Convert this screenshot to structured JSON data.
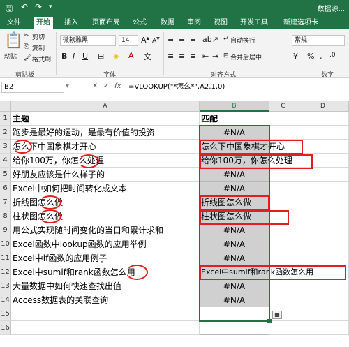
{
  "titlebar": {
    "save_icon": "save-icon",
    "undo_icon": "undo-icon",
    "redo_icon": "redo-icon",
    "title": "数据源..."
  },
  "tabs": [
    "文件",
    "开始",
    "插入",
    "页面布局",
    "公式",
    "数据",
    "审阅",
    "视图",
    "开发工具",
    "新建选项卡"
  ],
  "active_tab": 1,
  "ribbon": {
    "paste": "粘贴",
    "cut": "剪切",
    "copy": "复制",
    "format_painter": "格式刷",
    "clipboard_label": "剪贴板",
    "font_name": "微软雅黑",
    "font_size": "14",
    "bold": "B",
    "italic": "I",
    "underline": "U",
    "font_label": "字体",
    "wrap_text": "自动换行",
    "merge_center": "合并后居中",
    "align_label": "对齐方式",
    "number_format": "常规",
    "number_label": "数字",
    "percent": "%",
    "comma": ","
  },
  "formula_bar": {
    "cell_ref": "B2",
    "cancel": "✕",
    "confirm": "✓",
    "fx": "fx",
    "formula": "=VLOOKUP(\"*怎么*\",A2,1,0)"
  },
  "columns": [
    "A",
    "B",
    "C",
    "D"
  ],
  "rows": [
    {
      "n": "1",
      "a": "主题",
      "b": "匹配"
    },
    {
      "n": "2",
      "a": "跑步是最好的运动，是最有价值的投资",
      "b": "#N/A"
    },
    {
      "n": "3",
      "a": "怎么下中国象棋才开心",
      "b": "怎么下中国象棋才开心"
    },
    {
      "n": "4",
      "a": "给你100万，你怎么处理",
      "b": "给你100万，你怎么处理"
    },
    {
      "n": "5",
      "a": "好朋友应该是什么样子的",
      "b": "#N/A"
    },
    {
      "n": "6",
      "a": "Excel中如何把时间转化成文本",
      "b": "#N/A"
    },
    {
      "n": "7",
      "a": "折线图怎么做",
      "b": "折线图怎么做"
    },
    {
      "n": "8",
      "a": "柱状图怎么做",
      "b": "柱状图怎么做"
    },
    {
      "n": "9",
      "a": "用公式实现随时间变化的当日和累计求和",
      "b": "#N/A"
    },
    {
      "n": "10",
      "a": "Excel函数中lookup函数的应用举例",
      "b": "#N/A"
    },
    {
      "n": "11",
      "a": "Excel中if函数的应用例子",
      "b": "#N/A"
    },
    {
      "n": "12",
      "a": "Excel中sumif和rank函数怎么用",
      "b": "Excel中sumif和rank函数怎么用"
    },
    {
      "n": "13",
      "a": "大量数据中如何快速查找出值",
      "b": "#N/A"
    },
    {
      "n": "14",
      "a": "Access数据表的关联查询",
      "b": "#N/A"
    },
    {
      "n": "15",
      "a": "",
      "b": ""
    },
    {
      "n": "16",
      "a": "",
      "b": ""
    }
  ],
  "colors": {
    "excel_green": "#217346",
    "highlight_red": "#e02020",
    "cell_gray": "#d0d0d0"
  }
}
